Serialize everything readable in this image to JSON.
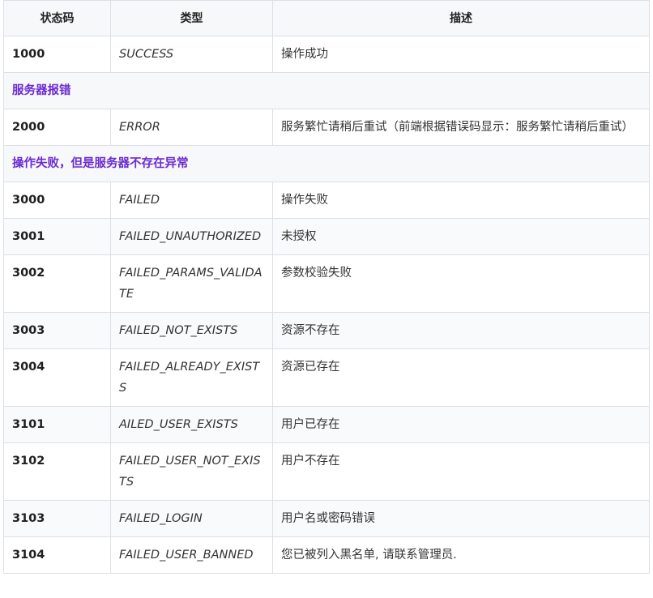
{
  "table": {
    "headers": [
      "状态码",
      "类型",
      "描述"
    ],
    "rows": [
      {
        "kind": "data",
        "code": "1000",
        "type": "SUCCESS",
        "desc": "操作成功"
      },
      {
        "kind": "section",
        "text": "服务器报错"
      },
      {
        "kind": "data",
        "code": "2000",
        "type": "ERROR",
        "desc": "服务繁忙请稍后重试（前端根据错误码显示：服务繁忙请稍后重试）"
      },
      {
        "kind": "section",
        "text": "操作失败，但是服务器不存在异常"
      },
      {
        "kind": "data",
        "code": "3000",
        "type": "FAILED",
        "desc": "操作失败"
      },
      {
        "kind": "data",
        "code": "3001",
        "type": "FAILED_UNAUTHORIZED",
        "desc": "未授权"
      },
      {
        "kind": "data",
        "code": "3002",
        "type": "FAILED_PARAMS_VALIDATE",
        "desc": "参数校验失败"
      },
      {
        "kind": "data",
        "code": "3003",
        "type": "FAILED_NOT_EXISTS",
        "desc": "资源不存在"
      },
      {
        "kind": "data",
        "code": "3004",
        "type": "FAILED_ALREADY_EXISTS",
        "desc": "资源已存在"
      },
      {
        "kind": "data",
        "code": "3101",
        "type": "AILED_USER_EXISTS",
        "desc": "用户已存在"
      },
      {
        "kind": "data",
        "code": "3102",
        "type": "FAILED_USER_NOT_EXISTS",
        "desc": "用户不存在"
      },
      {
        "kind": "data",
        "code": "3103",
        "type": "FAILED_LOGIN",
        "desc": "用户名或密码错误"
      },
      {
        "kind": "data",
        "code": "3104",
        "type": "FAILED_USER_BANNED",
        "desc": "您已被列入黑名单, 请联系管理员."
      }
    ]
  },
  "colors": {
    "section_text": "#6a2bd1",
    "header_bg": "#f7f8fa",
    "border": "#dcdfe6"
  }
}
